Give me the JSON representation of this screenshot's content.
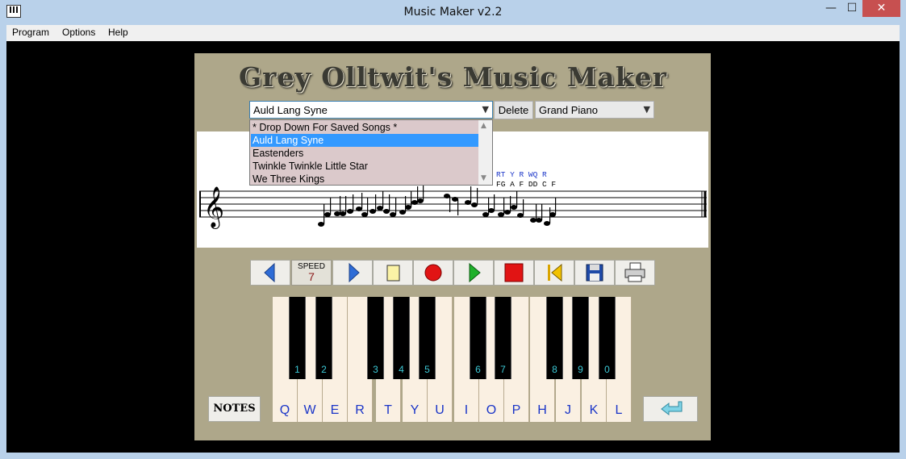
{
  "window": {
    "title": "Music Maker v2.2",
    "minimize": "—",
    "maximize": "☐",
    "close": "✕"
  },
  "menu": [
    "Program",
    "Options",
    "Help"
  ],
  "header": {
    "logo_text": "Grey Olltwit's Music Maker"
  },
  "song_select": {
    "value": "Auld Lang Syne"
  },
  "delete_button": "Delete",
  "instrument_select": {
    "value": "Grand Piano"
  },
  "song_dropdown": {
    "items": [
      "* Drop Down For Saved Songs *",
      "Auld Lang Syne",
      "Eastenders",
      "Twinkle Twinkle Little Star",
      "We Three Kings"
    ],
    "selected_index": 1
  },
  "staff": {
    "key_label_rows": [
      "RT Y R  WQ R",
      "FG A F  DD C F"
    ]
  },
  "toolbar": {
    "buttons": [
      {
        "name": "prev-button",
        "icon": "left-triangle-icon"
      },
      {
        "name": "next-button",
        "icon": "right-triangle-icon"
      },
      {
        "name": "new-button",
        "icon": "new-page-icon"
      },
      {
        "name": "record-button",
        "icon": "record-icon"
      },
      {
        "name": "play-button",
        "icon": "play-icon"
      },
      {
        "name": "stop-button",
        "icon": "stop-icon"
      },
      {
        "name": "rewind-button",
        "icon": "rewind-to-start-icon"
      },
      {
        "name": "save-button",
        "icon": "floppy-disk-icon"
      },
      {
        "name": "print-button",
        "icon": "printer-icon"
      }
    ],
    "speed_label": "SPEED",
    "speed_value": "7"
  },
  "keyboard": {
    "white_keys": [
      "Q",
      "W",
      "E",
      "R",
      "T",
      "Y",
      "U",
      "I",
      "O",
      "P",
      "H",
      "J",
      "K",
      "L"
    ],
    "black_keys": [
      "1",
      "2",
      "3",
      "4",
      "5",
      "6",
      "7",
      "8",
      "9",
      "0"
    ]
  },
  "notes_button": "NOTES",
  "colors": {
    "panel": "#aea78a",
    "key_letter": "#1a35c8",
    "black_key_label": "#3cc9d6",
    "selection": "#3399ff",
    "dropdown_bg": "#dbc9cb"
  }
}
